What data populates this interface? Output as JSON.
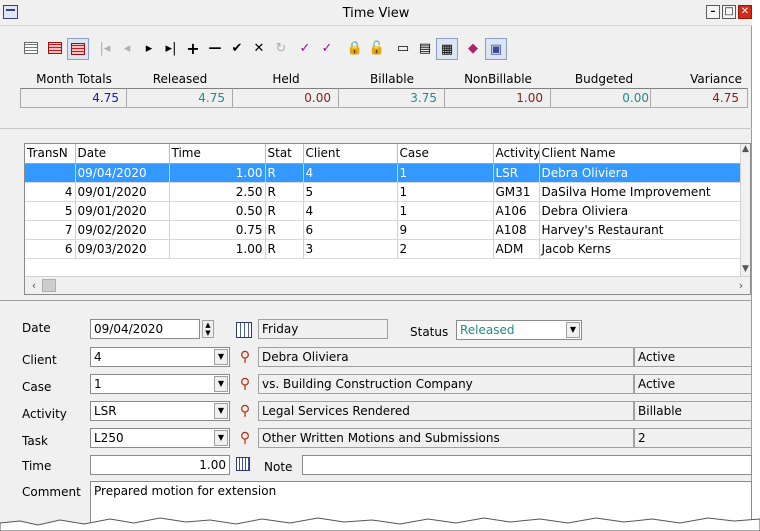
{
  "window": {
    "title": "Time View",
    "minimize": "–",
    "maximize": "□",
    "close": "✕"
  },
  "toolbar": {
    "buttons": [
      {
        "name": "grid-view-icon",
        "glyph": ""
      },
      {
        "name": "grid-red-icon",
        "glyph": ""
      },
      {
        "name": "grid-active-icon",
        "glyph": ""
      },
      {
        "name": "first-record-icon",
        "glyph": "|◂"
      },
      {
        "name": "prev-record-icon",
        "glyph": "◂"
      },
      {
        "name": "next-record-icon",
        "glyph": "▸"
      },
      {
        "name": "last-record-icon",
        "glyph": "▸|"
      },
      {
        "name": "add-record-icon",
        "glyph": "+"
      },
      {
        "name": "delete-record-icon",
        "glyph": "—"
      },
      {
        "name": "post-edit-icon",
        "glyph": "✔"
      },
      {
        "name": "cancel-edit-icon",
        "glyph": "✕"
      },
      {
        "name": "refresh-icon",
        "glyph": "↻"
      },
      {
        "name": "spellcheck-icon",
        "glyph": "✓"
      },
      {
        "name": "synonym-icon",
        "glyph": "✓"
      },
      {
        "name": "lock-icon",
        "glyph": "🔒"
      },
      {
        "name": "unlock-icon",
        "glyph": "🔓"
      },
      {
        "name": "form-view-icon",
        "glyph": "▭"
      },
      {
        "name": "list-view-icon",
        "glyph": "▤"
      },
      {
        "name": "split-view-icon",
        "glyph": "▦"
      },
      {
        "name": "book-icon",
        "glyph": "◆"
      },
      {
        "name": "report-icon",
        "glyph": "▣"
      }
    ]
  },
  "totals": [
    {
      "label": "Month Totals",
      "value": "4.75",
      "color": "#1a1ab0"
    },
    {
      "label": "Released",
      "value": "4.75",
      "color": "#238b8b"
    },
    {
      "label": "Held",
      "value": "0.00",
      "color": "#8b1a1a"
    },
    {
      "label": "Billable",
      "value": "3.75",
      "color": "#238b8b"
    },
    {
      "label": "NonBillable",
      "value": "1.00",
      "color": "#8b1a1a"
    },
    {
      "label": "Budgeted",
      "value": "0.00",
      "color": "#238b8b"
    },
    {
      "label": "Variance",
      "value": "4.75",
      "color": "#8b1a1a"
    }
  ],
  "grid": {
    "columns": [
      "TransN",
      "Date",
      "Time",
      "Stat",
      "Client",
      "Case",
      "Activity",
      "Client Name"
    ],
    "rows": [
      {
        "trans": "",
        "date": "09/04/2020",
        "time": "1.00",
        "stat": "R",
        "client": "4",
        "case": "1",
        "activity": "LSR",
        "client_name": "Debra Oliviera",
        "selected": true
      },
      {
        "trans": "4",
        "date": "09/01/2020",
        "time": "2.50",
        "stat": "R",
        "client": "5",
        "case": "1",
        "activity": "GM31",
        "client_name": "DaSilva Home Improvement",
        "selected": false
      },
      {
        "trans": "5",
        "date": "09/01/2020",
        "time": "0.50",
        "stat": "R",
        "client": "4",
        "case": "1",
        "activity": "A106",
        "client_name": "Debra Oliviera",
        "selected": false
      },
      {
        "trans": "7",
        "date": "09/02/2020",
        "time": "0.75",
        "stat": "R",
        "client": "6",
        "case": "9",
        "activity": "A108",
        "client_name": "Harvey's Restaurant",
        "selected": false
      },
      {
        "trans": "6",
        "date": "09/03/2020",
        "time": "1.00",
        "stat": "R",
        "client": "3",
        "case": "2",
        "activity": "ADM",
        "client_name": "Jacob Kerns",
        "selected": false
      }
    ]
  },
  "form": {
    "date_label": "Date",
    "date": "09/04/2020",
    "weekday": "Friday",
    "status_label": "Status",
    "status": "Released",
    "client_label": "Client",
    "client": "4",
    "client_name": "Debra Oliviera",
    "client_status": "Active",
    "case_label": "Case",
    "case": "1",
    "case_name": "vs. Building Construction Company",
    "case_status": "Active",
    "activity_label": "Activity",
    "activity": "LSR",
    "activity_name": "Legal Services Rendered",
    "activity_type": "Billable",
    "task_label": "Task",
    "task": "L250",
    "task_name": "Other Written Motions and Submissions",
    "task_extra": "2",
    "time_label": "Time",
    "time": "1.00",
    "note_label": "Note",
    "note": "",
    "comment_label": "Comment",
    "comment": "Prepared motion for extension"
  }
}
